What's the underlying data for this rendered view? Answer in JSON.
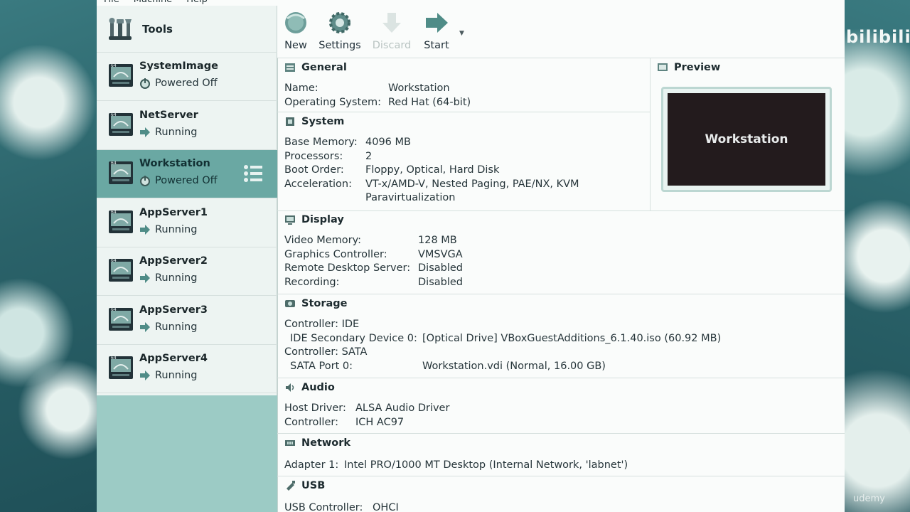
{
  "menu": [
    "File",
    "Machine",
    "Help"
  ],
  "watermark": "bilibili",
  "udemy": "udemy",
  "tools": {
    "label": "Tools"
  },
  "vms": [
    {
      "name": "SystemImage",
      "state": "Powered Off",
      "state_icon": "power-icon"
    },
    {
      "name": "NetServer",
      "state": "Running",
      "state_icon": "running-arrow-icon"
    },
    {
      "name": "Workstation",
      "state": "Powered Off",
      "state_icon": "power-icon",
      "selected": true
    },
    {
      "name": "AppServer1",
      "state": "Running",
      "state_icon": "running-arrow-icon"
    },
    {
      "name": "AppServer2",
      "state": "Running",
      "state_icon": "running-arrow-icon"
    },
    {
      "name": "AppServer3",
      "state": "Running",
      "state_icon": "running-arrow-icon"
    },
    {
      "name": "AppServer4",
      "state": "Running",
      "state_icon": "running-arrow-icon"
    }
  ],
  "toolbar": {
    "new": "New",
    "settings": "Settings",
    "discard": "Discard",
    "start": "Start"
  },
  "general": {
    "title": "General",
    "name_label": "Name:",
    "name_value": "Workstation",
    "os_label": "Operating System:",
    "os_value": "Red Hat (64-bit)"
  },
  "preview": {
    "title": "Preview",
    "screen_text": "Workstation"
  },
  "system": {
    "title": "System",
    "rows": [
      {
        "label": "Base Memory:",
        "value": "4096 MB"
      },
      {
        "label": "Processors:",
        "value": "2"
      },
      {
        "label": "Boot Order:",
        "value": "Floppy, Optical, Hard Disk"
      },
      {
        "label": "Acceleration:",
        "value": "VT-x/AMD-V, Nested Paging, PAE/NX, KVM"
      },
      {
        "label": "",
        "value": "Paravirtualization"
      }
    ]
  },
  "display": {
    "title": "Display",
    "rows": [
      {
        "label": "Video Memory:",
        "value": "128 MB"
      },
      {
        "label": "Graphics Controller:",
        "value": "VMSVGA"
      },
      {
        "label": "Remote Desktop Server:",
        "value": "Disabled"
      },
      {
        "label": "Recording:",
        "value": "Disabled"
      }
    ]
  },
  "storage": {
    "title": "Storage",
    "controller_ide": "Controller: IDE",
    "ide_label": "IDE Secondary Device 0:",
    "ide_value": "[Optical Drive] VBoxGuestAdditions_6.1.40.iso (60.92 MB)",
    "controller_sata": "Controller: SATA",
    "sata_label": "SATA Port 0:",
    "sata_value": "Workstation.vdi (Normal, 16.00 GB)"
  },
  "audio": {
    "title": "Audio",
    "rows": [
      {
        "label": "Host Driver:",
        "value": "ALSA Audio Driver"
      },
      {
        "label": "Controller:",
        "value": "ICH AC97"
      }
    ]
  },
  "network": {
    "title": "Network",
    "adapter_label": "Adapter 1:",
    "adapter_value": "Intel PRO/1000 MT Desktop (Internal Network, 'labnet')"
  },
  "usb": {
    "title": "USB",
    "controller_label": "USB Controller:",
    "controller_value": "OHCI"
  }
}
